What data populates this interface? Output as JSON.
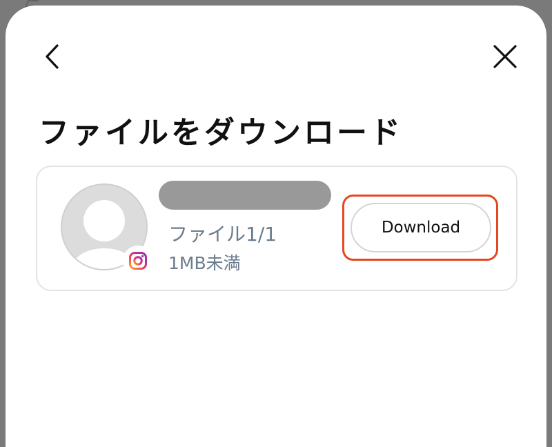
{
  "dialog": {
    "title": "ファイルをダウンロード"
  },
  "file": {
    "count_label": "ファイル1/1",
    "size_label": "1MB未満",
    "source_icon": "instagram-icon",
    "name_redacted": true
  },
  "actions": {
    "download_label": "Download"
  },
  "colors": {
    "highlight": "#e5471f",
    "meta_text": "#6b7c8c",
    "redaction": "#999999"
  }
}
